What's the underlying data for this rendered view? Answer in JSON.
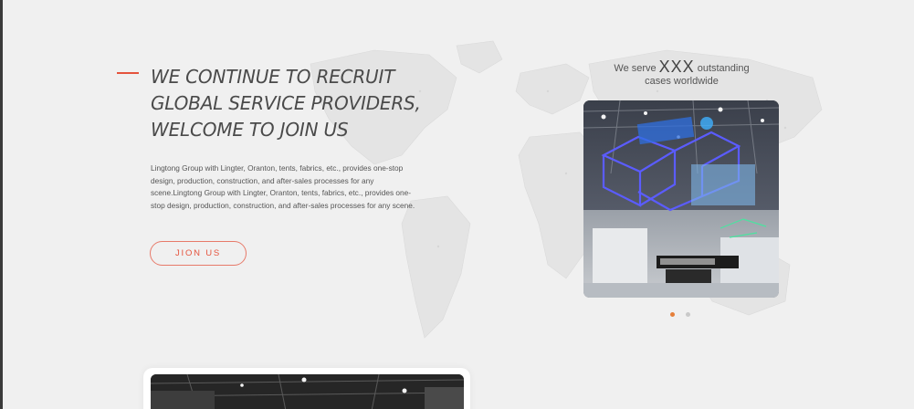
{
  "hero": {
    "headline_lines": [
      "WE CONTINUE TO RECRUIT",
      "GLOBAL SERVICE PROVIDERS,",
      "WELCOME TO JOIN US"
    ],
    "description": "Lingtong Group with Lingter, Oranton, tents, fabrics, etc., provides one-stop design, production, construction, and after-sales processes for any scene.Lingtong Group with Lingter, Oranton, tents, fabrics, etc., provides one-stop design, production, construction, and after-sales processes for any scene.",
    "join_label": "JION US"
  },
  "serve": {
    "prefix": "We serve",
    "count": "XXX",
    "suffix": "outstanding",
    "line2": "cases worldwide"
  },
  "colors": {
    "accent": "#e5533d",
    "background": "#f0f0f0",
    "dot_active": "#e57f3a",
    "dot_inactive": "#c9c9c9"
  },
  "carousel": {
    "slide_count": 2,
    "active_index": 0
  }
}
